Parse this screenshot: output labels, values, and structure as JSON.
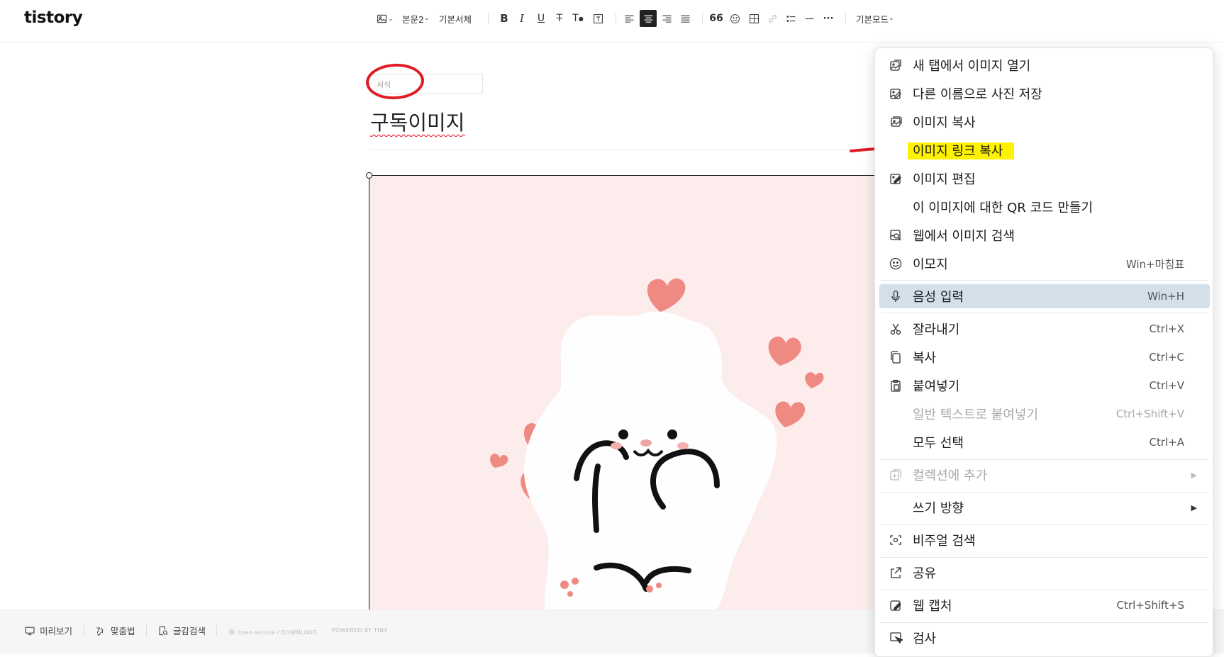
{
  "app": {
    "logo": "tistory"
  },
  "toolbar": {
    "paragraph_style": "본문2",
    "font": "기본서체",
    "mode": "기본모드"
  },
  "editor": {
    "format_placeholder": "서식",
    "post_title": "구독이미지"
  },
  "bottom_bar": {
    "preview": "미리보기",
    "spellcheck": "맞춤법",
    "search": "글감검색",
    "open_source": "open source / DOWNLOAD",
    "powered": "POWERED BY TINY"
  },
  "context_menu": {
    "items": [
      {
        "label": "새 탭에서 이미지 열기",
        "shortcut": "",
        "icon": "open-image-new-tab-icon"
      },
      {
        "label": "다른 이름으로 사진 저장",
        "shortcut": "",
        "icon": "save-image-icon"
      },
      {
        "label": "이미지 복사",
        "shortcut": "",
        "icon": "copy-image-icon"
      },
      {
        "label": "이미지 링크 복사",
        "shortcut": "",
        "icon": ""
      },
      {
        "label": "이미지 편집",
        "shortcut": "",
        "icon": "edit-image-icon"
      },
      {
        "label": "이 이미지에 대한 QR 코드 만들기",
        "shortcut": "",
        "icon": ""
      },
      {
        "label": "웹에서 이미지 검색",
        "shortcut": "",
        "icon": "search-image-web-icon"
      },
      {
        "label": "이모지",
        "shortcut": "Win+마침표",
        "icon": "emoji-icon"
      },
      {
        "label": "음성 입력",
        "shortcut": "Win+H",
        "icon": "microphone-icon"
      },
      {
        "label": "잘라내기",
        "shortcut": "Ctrl+X",
        "icon": "scissors-icon"
      },
      {
        "label": "복사",
        "shortcut": "Ctrl+C",
        "icon": "copy-icon"
      },
      {
        "label": "붙여넣기",
        "shortcut": "Ctrl+V",
        "icon": "paste-icon"
      },
      {
        "label": "일반 텍스트로 붙여넣기",
        "shortcut": "Ctrl+Shift+V",
        "icon": "",
        "disabled": true
      },
      {
        "label": "모두 선택",
        "shortcut": "Ctrl+A",
        "icon": ""
      },
      {
        "label": "컬렉션에 추가",
        "shortcut": "",
        "icon": "add-to-collection-icon",
        "disabled": true,
        "submenu": true
      },
      {
        "label": "쓰기 방향",
        "shortcut": "",
        "icon": "",
        "submenu": true
      },
      {
        "label": "비주얼 검색",
        "shortcut": "",
        "icon": "visual-search-icon"
      },
      {
        "label": "공유",
        "shortcut": "",
        "icon": "share-icon"
      },
      {
        "label": "웹 캡처",
        "shortcut": "Ctrl+Shift+S",
        "icon": "web-capture-icon"
      },
      {
        "label": "검사",
        "shortcut": "",
        "icon": "inspect-icon"
      }
    ]
  },
  "colors": {
    "annotation_red": "#e01b24",
    "highlight_yellow": "#fff200",
    "menu_hover": "#d3e0ea",
    "image_bg": "#fcecec",
    "heart": "#ef8a82"
  }
}
